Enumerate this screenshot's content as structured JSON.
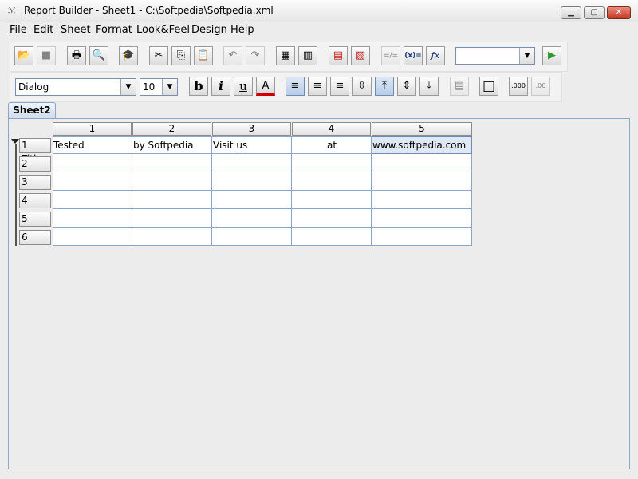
{
  "window": {
    "app_icon": "ℳ",
    "title": "Report Builder - Sheet1 - C:\\Softpedia\\Softpedia.xml",
    "controls": {
      "minimize": "▁",
      "maximize": "▢",
      "close": "✕"
    }
  },
  "menu": [
    "File",
    "Edit",
    "Sheet",
    "Format",
    "Look&Feel",
    "Design",
    "Help"
  ],
  "toolbar1": {
    "buttons": [
      {
        "name": "open-icon",
        "glyph": "📂"
      },
      {
        "name": "save-icon",
        "glyph": "■"
      },
      {
        "name": "print-icon",
        "glyph": "🖶"
      },
      {
        "name": "print-preview-icon",
        "glyph": "🔍"
      },
      {
        "name": "wizard-icon",
        "glyph": "🎓"
      },
      {
        "name": "cut-icon",
        "glyph": "✂"
      },
      {
        "name": "copy-icon",
        "glyph": "⎘"
      },
      {
        "name": "paste-icon",
        "glyph": "📋"
      },
      {
        "name": "undo-icon",
        "glyph": "↶"
      },
      {
        "name": "redo-icon",
        "glyph": "↷"
      },
      {
        "name": "insert-row-icon",
        "glyph": "▦"
      },
      {
        "name": "insert-column-icon",
        "glyph": "▥"
      },
      {
        "name": "delete-row-icon",
        "glyph": "▤"
      },
      {
        "name": "delete-column-icon",
        "glyph": "▧"
      },
      {
        "name": "equals-icon",
        "glyph": "=/="
      },
      {
        "name": "variable-icon",
        "glyph": "(x)="
      },
      {
        "name": "function-icon",
        "glyph": "ƒx"
      }
    ],
    "expression_value": "",
    "run_icon": "▶"
  },
  "toolbar2": {
    "font": "Dialog",
    "size": "10",
    "bold": "b",
    "italic": "i",
    "underline": "u",
    "buttons": [
      {
        "name": "font-color-icon",
        "glyph": "A"
      },
      {
        "name": "align-left-icon",
        "glyph": "≡"
      },
      {
        "name": "align-center-icon",
        "glyph": "≡"
      },
      {
        "name": "align-right-icon",
        "glyph": "≡"
      },
      {
        "name": "wrap-icon",
        "glyph": "⇳"
      },
      {
        "name": "valign-top-icon",
        "glyph": "⤒"
      },
      {
        "name": "valign-middle-icon",
        "glyph": "⇕"
      },
      {
        "name": "valign-bottom-icon",
        "glyph": "⤓"
      },
      {
        "name": "merge-cells-icon",
        "glyph": "▤"
      },
      {
        "name": "border-icon",
        "glyph": "□"
      },
      {
        "name": "decimal-increase-icon",
        "glyph": ".000"
      },
      {
        "name": "decimal-decrease-icon",
        "glyph": ".00"
      }
    ]
  },
  "sheet_tab": "Sheet2",
  "grid": {
    "columns": [
      "1",
      "2",
      "3",
      "4",
      "5"
    ],
    "rows": [
      {
        "header": "1 Title",
        "cells": [
          "Tested",
          "by Softpedia",
          "Visit us",
          "at",
          "www.softpedia.com"
        ]
      },
      {
        "header": "2",
        "cells": [
          "",
          "",
          "",
          "",
          ""
        ]
      },
      {
        "header": "3",
        "cells": [
          "",
          "",
          "",
          "",
          ""
        ]
      },
      {
        "header": "4",
        "cells": [
          "",
          "",
          "",
          "",
          ""
        ]
      },
      {
        "header": "5",
        "cells": [
          "",
          "",
          "",
          "",
          ""
        ]
      },
      {
        "header": "6",
        "cells": [
          "",
          "",
          "",
          "",
          ""
        ]
      }
    ]
  },
  "colors": {
    "accent": "#8aa6c8",
    "run": "#2e9a2e",
    "font_color": "#d00000"
  }
}
